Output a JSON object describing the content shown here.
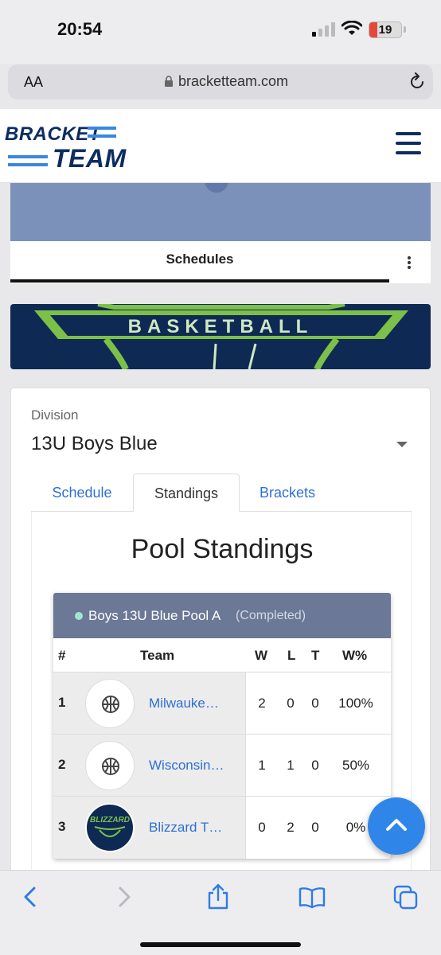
{
  "status_bar": {
    "time": "20:54",
    "battery": "19"
  },
  "browser": {
    "text_size_label": "AA",
    "url": "bracketteam.com"
  },
  "site": {
    "logo_line1": "BRACKET",
    "logo_line2": "TEAM"
  },
  "event_card": {
    "tab_title": "Schedules"
  },
  "banner": {
    "text": "BASKETBALL"
  },
  "division": {
    "label": "Division",
    "value": "13U Boys Blue",
    "tabs": [
      {
        "label": "Schedule",
        "active": false
      },
      {
        "label": "Standings",
        "active": true
      },
      {
        "label": "Brackets",
        "active": false
      }
    ]
  },
  "standings": {
    "title": "Pool Standings",
    "pool_name": "Boys 13U Blue Pool A",
    "pool_status": "(Completed)",
    "columns": {
      "rank": "#",
      "team": "Team",
      "w": "W",
      "l": "L",
      "t": "T",
      "pct": "W%"
    },
    "rows": [
      {
        "rank": "1",
        "team": "Milwauke…",
        "w": "2",
        "l": "0",
        "t": "0",
        "pct": "100%",
        "avatar": "basketball-icon"
      },
      {
        "rank": "2",
        "team": "Wisconsin…",
        "w": "1",
        "l": "1",
        "t": "0",
        "pct": "50%",
        "avatar": "basketball-icon"
      },
      {
        "rank": "3",
        "team": "Blizzard T…",
        "w": "0",
        "l": "2",
        "t": "0",
        "pct": "0%",
        "avatar": "blizzard-logo",
        "avatar_text": "BLIZZARD"
      }
    ]
  },
  "colors": {
    "brand_navy": "#0d2c63",
    "link_blue": "#2f6fd6",
    "pool_header": "#6b7896",
    "fab_blue": "#2f86e8"
  }
}
